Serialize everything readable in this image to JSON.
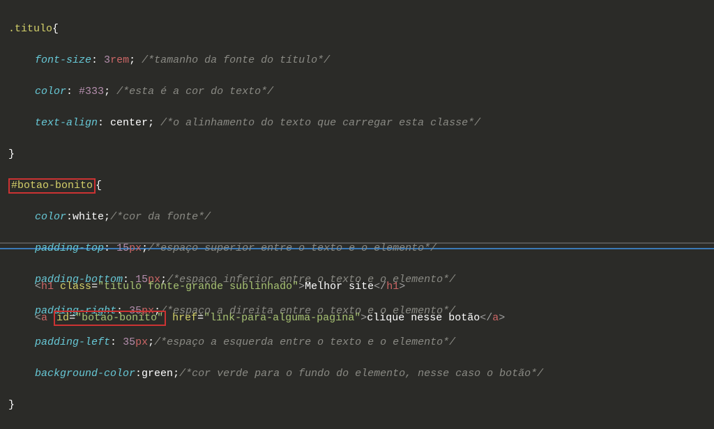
{
  "css": {
    "rule1": {
      "selector": ".titulo",
      "props": {
        "p1": {
          "name": "font-size",
          "num": "3",
          "unit": "rem",
          "comment": "/*tamanho da fonte do título*/"
        },
        "p2": {
          "name": "color",
          "val": "#333",
          "comment": "/*esta é a cor do texto*/"
        },
        "p3": {
          "name": "text-align",
          "val": "center",
          "comment": "/*o alinhamento do texto que carregar esta classe*/"
        }
      }
    },
    "rule2": {
      "selector": "#botao-bonito",
      "props": {
        "p1": {
          "name": "color",
          "val": "white",
          "comment": "/*cor da fonte*/"
        },
        "p2": {
          "name": "padding-top",
          "num": "15",
          "unit": "px",
          "comment": "/*espaço superior entre o texto e o elemento*/"
        },
        "p3": {
          "name": "padding-bottom",
          "num": "15",
          "unit": "px",
          "comment": "/*espaço inferior entre o texto e o elemento*/"
        },
        "p4": {
          "name": "padding-right",
          "num": "35",
          "unit": "px",
          "comment": "/*espaço a direita entre o texto e o elemento*/"
        },
        "p5": {
          "name": "padding-left",
          "num": "35",
          "unit": "px",
          "comment": "/*espaço a esquerda entre o texto e o elemento*/"
        },
        "p6": {
          "name": "background-color",
          "val": "green",
          "comment": "/*cor verde para o fundo do elemento, nesse caso o botão*/"
        }
      }
    }
  },
  "html": {
    "h1": {
      "tag": "h1",
      "attrClass": "class",
      "classVal": "\"titulo fonte-grande sublinhado\"",
      "text": "Melhor site"
    },
    "a": {
      "tag": "a",
      "attrId": "id",
      "idVal": "\"botao-bonito\"",
      "attrHref": "href",
      "hrefVal": "\"link-para-alguma-pagina\"",
      "text": "clique nesse botão"
    }
  },
  "punct": {
    "openBrace": "{",
    "closeBrace": "}",
    "colon": ":",
    "space": " ",
    "semi": ";",
    "lt": "<",
    "gt": ">",
    "ltSlash": "</",
    "eq": "="
  }
}
